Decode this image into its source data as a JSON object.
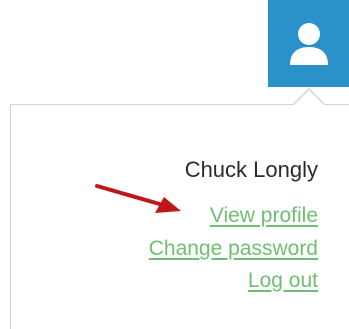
{
  "user": {
    "name": "Chuck Longly",
    "avatar_icon": "user-icon"
  },
  "menu": {
    "view_profile": "View profile",
    "change_password": "Change password",
    "log_out": "Log out"
  },
  "colors": {
    "avatar_bg": "#2b91c9",
    "link": "#6fbf73",
    "annotation_arrow": "#c0161b"
  }
}
